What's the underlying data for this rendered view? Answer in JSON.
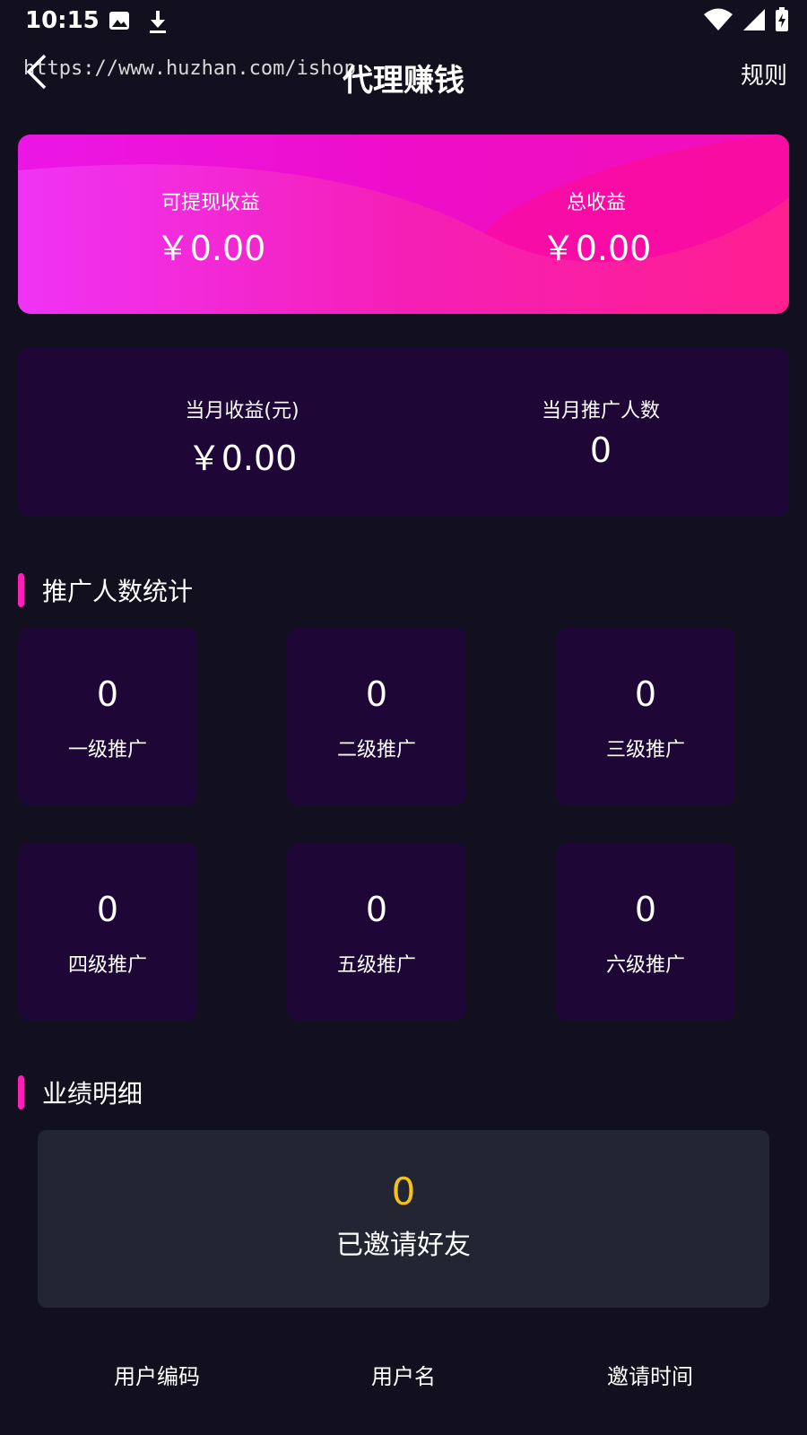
{
  "status_bar": {
    "time": "10:15",
    "left_icons": [
      "image-icon",
      "download-icon"
    ],
    "right_icons": [
      "wifi-icon",
      "signal-icon",
      "battery-charging-icon"
    ]
  },
  "top_bar": {
    "watermark": "https://www.huzhan.com/ishop",
    "title": "代理赚钱",
    "rules": "规则"
  },
  "earnings": {
    "withdrawable_label": "可提现收益",
    "withdrawable_value": "￥0.00",
    "total_label": "总收益",
    "total_value": "￥0.00"
  },
  "monthly": {
    "income_label": "当月收益(元)",
    "income_value": "￥0.00",
    "promoted_label": "当月推广人数",
    "promoted_value": "0"
  },
  "promo_stats": {
    "title": "推广人数统计",
    "levels": [
      {
        "label": "一级推广",
        "count": "0"
      },
      {
        "label": "二级推广",
        "count": "0"
      },
      {
        "label": "三级推广",
        "count": "0"
      },
      {
        "label": "四级推广",
        "count": "0"
      },
      {
        "label": "五级推广",
        "count": "0"
      },
      {
        "label": "六级推广",
        "count": "0"
      }
    ]
  },
  "performance": {
    "title": "业绩明细",
    "invited_count": "0",
    "invited_label": "已邀请好友"
  },
  "table": {
    "columns": [
      "用户编码",
      "用户名",
      "邀请时间"
    ]
  },
  "colors": {
    "background": "#12101f",
    "card_dark": "#1e0736",
    "accent_pink": "#ff1fb8",
    "highlight_yellow": "#f6c21a",
    "perf_card": "#232533"
  }
}
